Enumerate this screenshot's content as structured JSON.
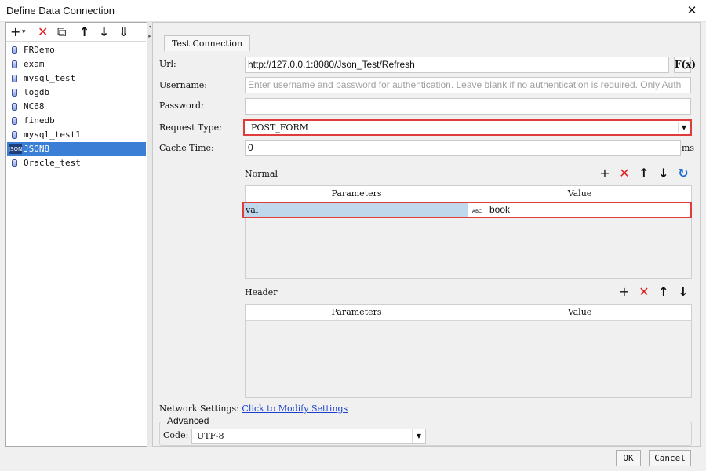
{
  "window": {
    "title": "Define Data Connection"
  },
  "sidebar": {
    "toolbar": {
      "add": "+",
      "add_dropdown": "▾",
      "delete": "✕",
      "copy": "⧉",
      "move_up": "↑",
      "move_down": "↓",
      "sort": "⇓"
    },
    "items": [
      {
        "label": "FRDemo",
        "icon": "database-icon"
      },
      {
        "label": "exam",
        "icon": "database-icon"
      },
      {
        "label": "mysql_test",
        "icon": "database-icon"
      },
      {
        "label": "logdb",
        "icon": "database-icon"
      },
      {
        "label": "NC68",
        "icon": "database-icon"
      },
      {
        "label": "finedb",
        "icon": "database-icon"
      },
      {
        "label": "mysql_test1",
        "icon": "database-icon"
      },
      {
        "label": "JSON8",
        "icon": "json-icon",
        "icon_text": "JSON",
        "selected": true
      },
      {
        "label": "Oracle_test",
        "icon": "database-icon"
      }
    ]
  },
  "main": {
    "test_connection": "Test Connection",
    "url_label": "Url:",
    "url_value": "http://127.0.0.1:8080/Json_Test/Refresh",
    "formula_label": "F(x)",
    "username_label": "Username:",
    "username_placeholder": "Enter username and password for authentication. Leave blank if no authentication is required. Only Auth",
    "password_label": "Password:",
    "password_value": "",
    "request_type_label": "Request Type:",
    "request_type_value": "POST_FORM",
    "cache_time_label": "Cache Time:",
    "cache_time_value": "0",
    "cache_time_unit": "ms",
    "normal": {
      "title": "Normal",
      "columns": [
        "Parameters",
        "Value"
      ],
      "rows": [
        {
          "parameter": "val",
          "value": "book",
          "type_badge": "ABC"
        }
      ]
    },
    "header": {
      "title": "Header",
      "columns": [
        "Parameters",
        "Value"
      ],
      "rows": []
    },
    "network_label": "Network Settings:",
    "network_link": "Click to Modify Settings",
    "advanced_label": "Advanced",
    "code_label": "Code:",
    "code_value": "UTF-8"
  },
  "footer": {
    "ok": "OK",
    "cancel": "Cancel"
  },
  "colors": {
    "selection": "#3a7fd5",
    "highlight_border": "#e03c3c",
    "delete_red": "#e02020",
    "refresh_blue": "#1f6fd0",
    "link": "#1a3fcc"
  }
}
